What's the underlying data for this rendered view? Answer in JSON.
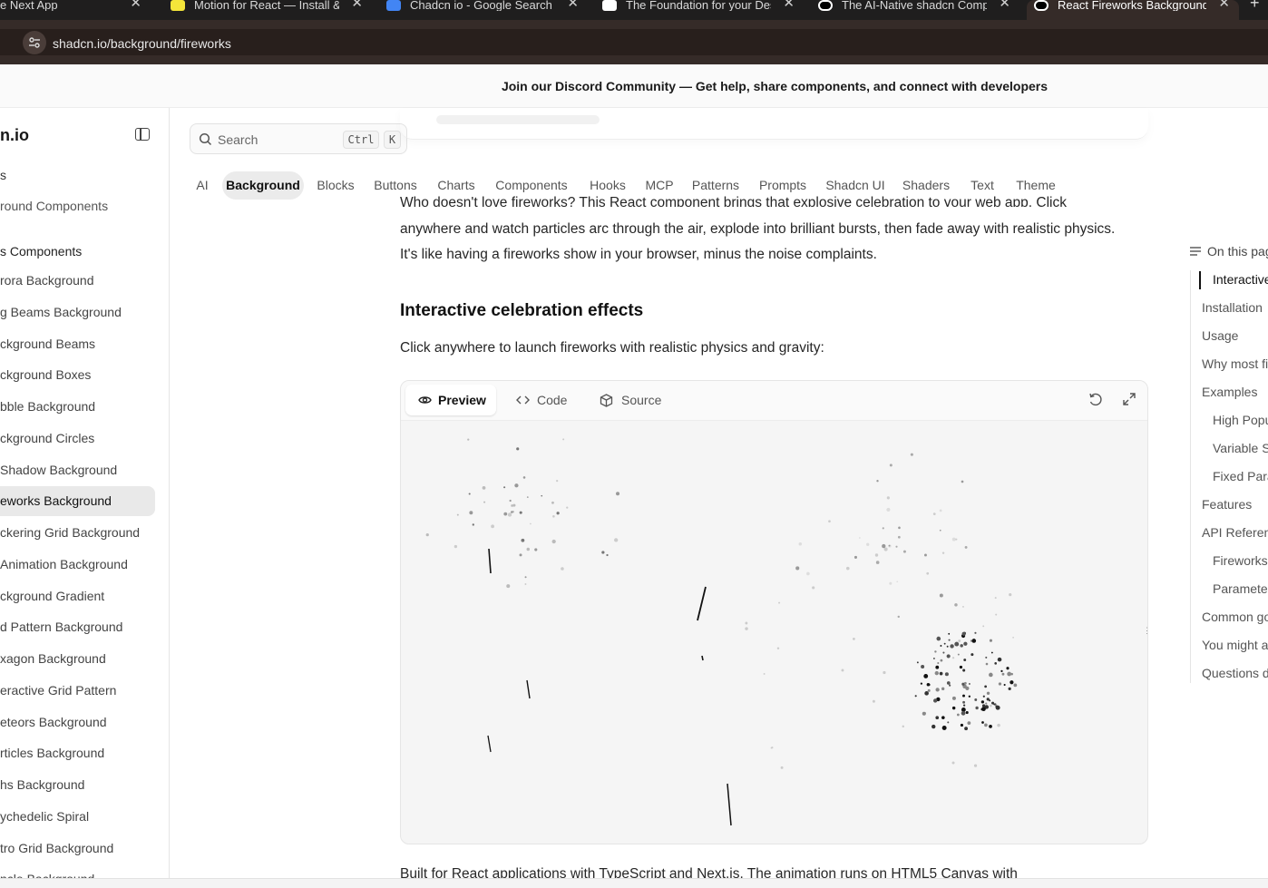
{
  "browser": {
    "tabs": [
      {
        "title": "e Next App",
        "favicon_color": "#1f1e1e"
      },
      {
        "title": "Motion for React — Install & fir",
        "favicon_color": "#f5e63a"
      },
      {
        "title": "Chadcn io - Google Search",
        "favicon_color": "#4285f4"
      },
      {
        "title": "The Foundation for your Design",
        "favicon_color": "#ffffff"
      },
      {
        "title": "The AI-Native shadcn Compone",
        "favicon_color": "#000000"
      },
      {
        "title": "React Fireworks Background",
        "favicon_color": "#000000"
      }
    ],
    "active_tab": 5,
    "close_glyph": "✕",
    "new_tab_glyph": "+",
    "url": "shadcn.io/background/fireworks"
  },
  "banner": {
    "text": "Join our Discord Community — Get help, share components, and connect with developers"
  },
  "sidebar": {
    "brand": "n.io",
    "section_1": "s",
    "category": "round Components",
    "group_title": "s Components",
    "items": [
      {
        "label": "rora Background"
      },
      {
        "label": "g Beams Background"
      },
      {
        "label": "ckground Beams"
      },
      {
        "label": "ckground Boxes"
      },
      {
        "label": "bble Background"
      },
      {
        "label": "ckground Circles"
      },
      {
        "label": "Shadow Background"
      },
      {
        "label": "eworks Background"
      },
      {
        "label": "ckering Grid Background"
      },
      {
        "label": "Animation Background"
      },
      {
        "label": "ckground Gradient"
      },
      {
        "label": "d Pattern Background"
      },
      {
        "label": "xagon Background"
      },
      {
        "label": "eractive Grid Pattern"
      },
      {
        "label": "eteors Background"
      },
      {
        "label": "rticles Background"
      },
      {
        "label": "hs Background"
      },
      {
        "label": "ychedelic Spiral"
      },
      {
        "label": "tro Grid Background"
      },
      {
        "label": "ncle Background"
      }
    ],
    "active_index": 7
  },
  "search": {
    "placeholder": "Search",
    "shortcut_1": "Ctrl",
    "shortcut_2": "K"
  },
  "categories": [
    "AI",
    "Background",
    "Blocks",
    "Buttons",
    "Charts",
    "Components",
    "Hooks",
    "MCP",
    "Patterns",
    "Prompts",
    "Shadcn UI",
    "Shaders",
    "Text",
    "Theme"
  ],
  "active_category": 1,
  "content": {
    "intro_line_1": "Who doesn't love fireworks? This React component brings that explosive celebration to your web app. Click",
    "intro_line_2": "anywhere and watch particles arc through the air, explode into brilliant bursts, then fade away with realistic physics.",
    "intro_line_3": "It's like having a fireworks show in your browser, minus the noise complaints.",
    "heading": "Interactive celebration effects",
    "demo_intro": "Click anywhere to launch fireworks with realistic physics and gravity:",
    "bottom_line": "Built for React applications with TypeScript and Next.js. The animation runs on HTML5 Canvas with"
  },
  "preview": {
    "tabs": [
      {
        "label": "Preview",
        "icon": "eye-icon"
      },
      {
        "label": "Code",
        "icon": "code-icon"
      },
      {
        "label": "Source",
        "icon": "box-icon"
      }
    ],
    "active_tab": 0,
    "actions": [
      "refresh-icon",
      "expand-icon"
    ],
    "handle_glyph": "⋮"
  },
  "toc": {
    "title": "On this page",
    "items": [
      {
        "label": "Interactive",
        "indent": true
      },
      {
        "label": "Installation",
        "indent": false
      },
      {
        "label": "Usage",
        "indent": false
      },
      {
        "label": "Why most fi",
        "indent": false
      },
      {
        "label": "Examples",
        "indent": false
      },
      {
        "label": "High Popu",
        "indent": true
      },
      {
        "label": "Variable S",
        "indent": true
      },
      {
        "label": "Fixed Para",
        "indent": true
      },
      {
        "label": "Features",
        "indent": false
      },
      {
        "label": "API Referen",
        "indent": false
      },
      {
        "label": "Fireworks",
        "indent": true
      },
      {
        "label": "Paramete",
        "indent": true
      },
      {
        "label": "Common go",
        "indent": false
      },
      {
        "label": "You might a",
        "indent": false
      },
      {
        "label": "Questions d",
        "indent": false
      }
    ],
    "active_index": 0
  }
}
